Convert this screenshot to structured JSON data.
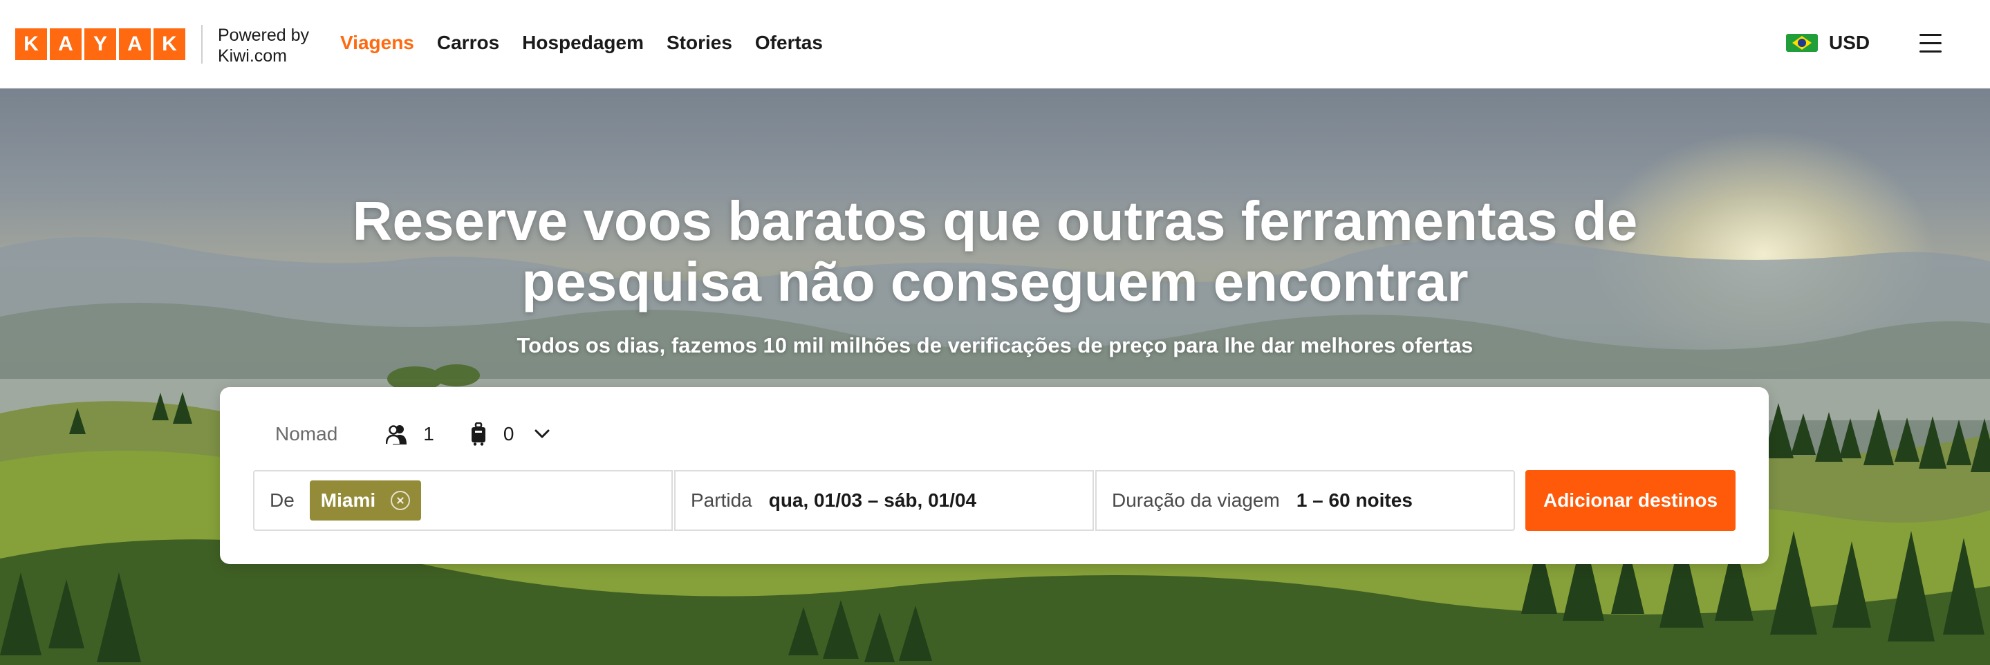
{
  "header": {
    "logo_letters": [
      "K",
      "A",
      "Y",
      "A",
      "K"
    ],
    "powered_line1": "Powered by",
    "powered_line2": "Kiwi.com",
    "nav": [
      {
        "label": "Viagens",
        "active": true
      },
      {
        "label": "Carros",
        "active": false
      },
      {
        "label": "Hospedagem",
        "active": false
      },
      {
        "label": "Stories",
        "active": false
      },
      {
        "label": "Ofertas",
        "active": false
      }
    ],
    "currency": "USD",
    "flag_icon": "brazil-flag-icon",
    "menu_icon": "hamburger-menu-icon"
  },
  "hero": {
    "headline_line1": "Reserve voos baratos que outras ferramentas de",
    "headline_line2": "pesquisa não conseguem encontrar",
    "subline": "Todos os dias, fazemos 10 mil milhões de verificações de preço para lhe dar melhores ofertas"
  },
  "search": {
    "trip_mode": "Nomad",
    "passengers": "1",
    "bags": "0",
    "from_label": "De",
    "from_chip": "Miami",
    "date_label": "Partida",
    "date_value": "qua, 01/03 – sáb, 01/04",
    "duration_label": "Duração da viagem",
    "duration_value": "1 – 60 noites",
    "cta_label": "Adicionar destinos"
  },
  "colors": {
    "brand_orange": "#ff690f",
    "cta_orange": "#ff5a0a",
    "chip_olive": "#938b37"
  }
}
